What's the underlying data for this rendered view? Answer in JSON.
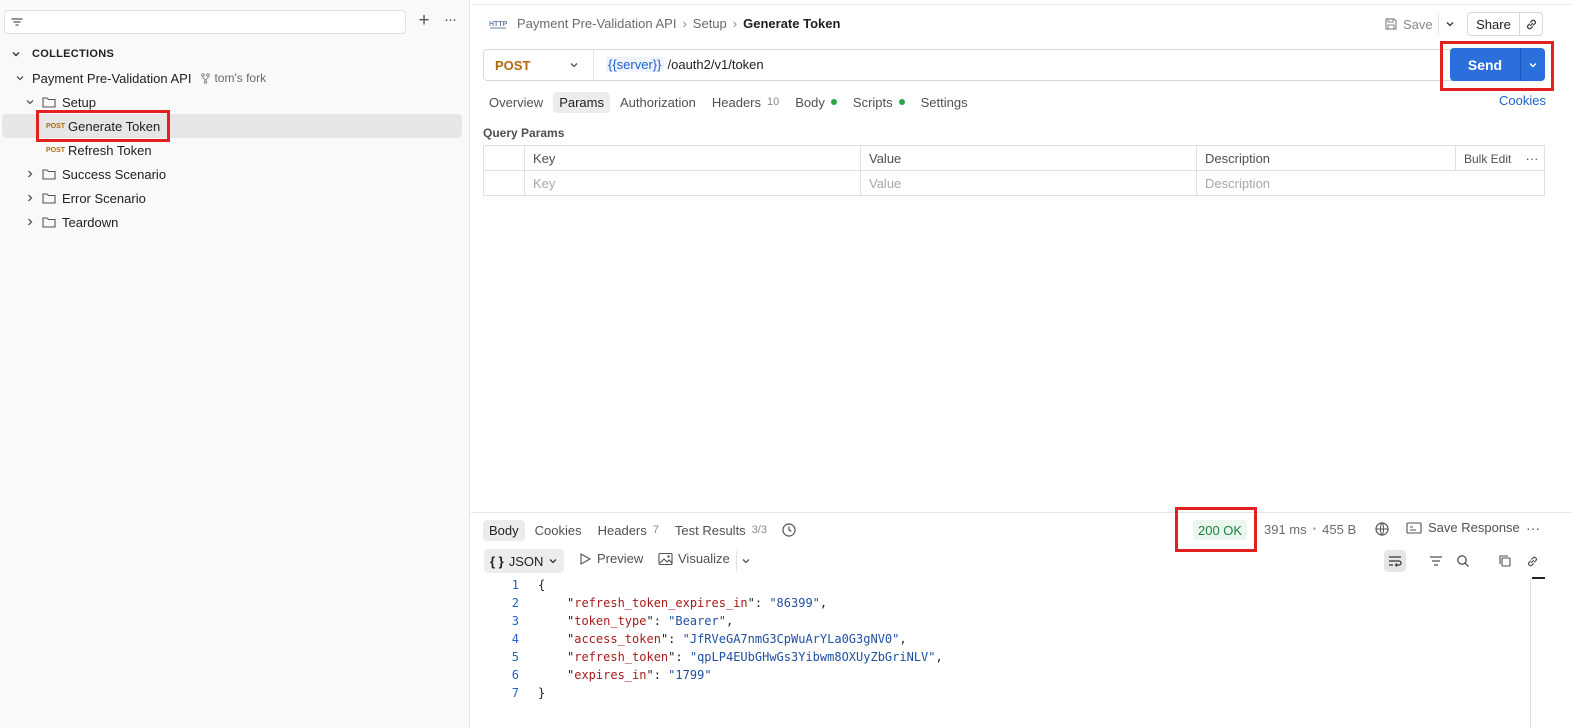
{
  "sidebar": {
    "collections_label": "COLLECTIONS",
    "collection": {
      "name": "Payment Pre-Validation API",
      "fork": "tom's fork"
    },
    "folders": [
      {
        "name": "Setup",
        "requests": [
          {
            "method": "POST",
            "name": "Generate Token"
          },
          {
            "method": "POST",
            "name": "Refresh Token"
          }
        ]
      },
      {
        "name": "Success Scenario"
      },
      {
        "name": "Error Scenario"
      },
      {
        "name": "Teardown"
      }
    ]
  },
  "header": {
    "breadcrumb": [
      "Payment Pre-Validation API",
      "Setup",
      "Generate Token"
    ],
    "save_label": "Save",
    "share_label": "Share"
  },
  "request": {
    "method": "POST",
    "url_variable": "{{server}}",
    "url_path": "/oauth2/v1/token",
    "send_label": "Send",
    "tabs": [
      {
        "label": "Overview"
      },
      {
        "label": "Params"
      },
      {
        "label": "Authorization"
      },
      {
        "label": "Headers",
        "count": "10"
      },
      {
        "label": "Body"
      },
      {
        "label": "Scripts"
      },
      {
        "label": "Settings"
      }
    ],
    "cookies_label": "Cookies"
  },
  "query_params": {
    "title": "Query Params",
    "headers": [
      "Key",
      "Value",
      "Description"
    ],
    "bulk_edit": "Bulk Edit",
    "placeholders": [
      "Key",
      "Value",
      "Description"
    ]
  },
  "response": {
    "tabs": [
      {
        "label": "Body"
      },
      {
        "label": "Cookies"
      },
      {
        "label": "Headers",
        "count": "7"
      },
      {
        "label": "Test Results",
        "count": "3/3"
      }
    ],
    "status": "200 OK",
    "time": "391 ms",
    "size": "455 B",
    "save_response_label": "Save Response",
    "format": "JSON",
    "preview_label": "Preview",
    "visualize_label": "Visualize",
    "body_lines": [
      {
        "n": "1",
        "text": "{"
      },
      {
        "n": "2",
        "key": "refresh_token_expires_in",
        "value": "86399",
        "comma": true
      },
      {
        "n": "3",
        "key": "token_type",
        "value": "Bearer",
        "comma": true
      },
      {
        "n": "4",
        "key": "access_token",
        "value": "JfRVeGA7nmG3CpWuArYLa0G3gNV0",
        "comma": true
      },
      {
        "n": "5",
        "key": "refresh_token",
        "value": "qpLP4EUbGHwGs3Yibwm8OXUyZbGriNLV",
        "comma": true
      },
      {
        "n": "6",
        "key": "expires_in",
        "value": "1799",
        "comma": false
      },
      {
        "n": "7",
        "text": "}"
      }
    ]
  },
  "colors": {
    "accent": "#2a6fdb",
    "post_method": "#b06a0a",
    "status_ok": "#1e7f3c",
    "highlight": "#e32020"
  }
}
